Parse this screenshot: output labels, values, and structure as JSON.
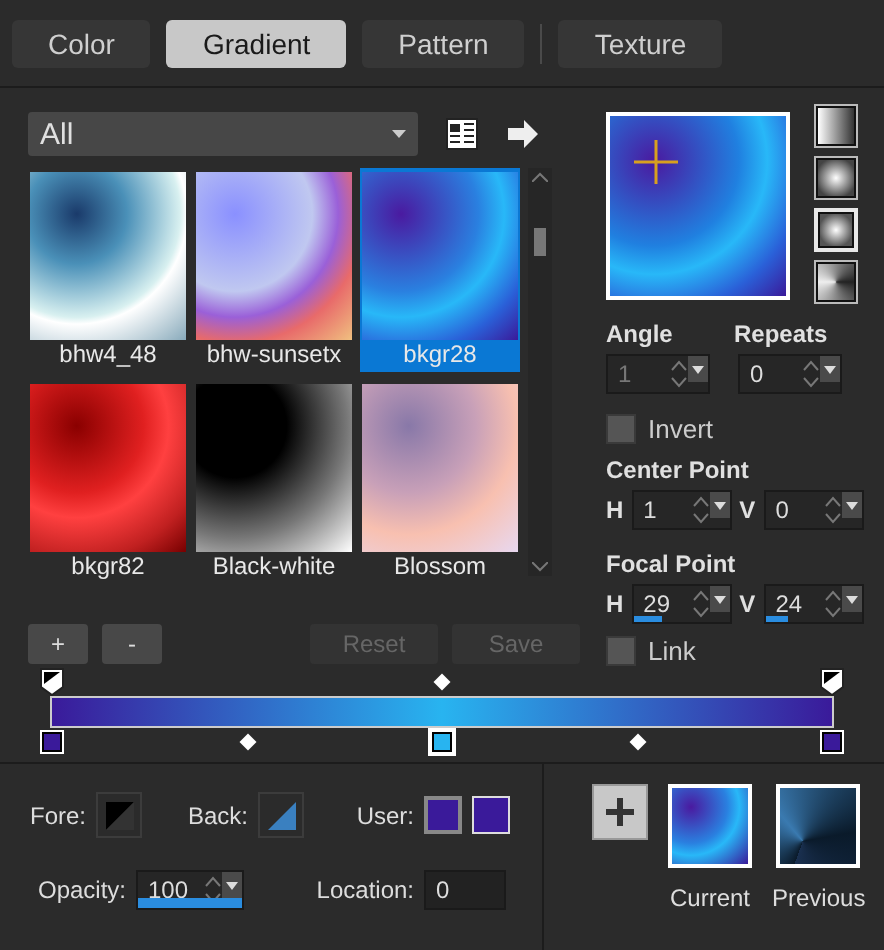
{
  "tabs": [
    {
      "label": "Color",
      "selected": false
    },
    {
      "label": "Gradient",
      "selected": true
    },
    {
      "label": "Pattern",
      "selected": false
    },
    {
      "label": "Texture",
      "selected": false
    }
  ],
  "category": {
    "value": "All"
  },
  "presets": [
    {
      "name": "bhw4_48",
      "selected": false
    },
    {
      "name": "bhw-sunsetx",
      "selected": false
    },
    {
      "name": "bkgr28",
      "selected": true
    },
    {
      "name": "bkgr82",
      "selected": false
    },
    {
      "name": "Black-white",
      "selected": false
    },
    {
      "name": "Blossom",
      "selected": false
    }
  ],
  "preset_buttons": [
    {
      "label": "+",
      "disabled": false
    },
    {
      "label": "-",
      "disabled": false
    },
    {
      "label": "Reset",
      "disabled": true
    },
    {
      "label": "Save",
      "disabled": true
    }
  ],
  "styles": [
    {
      "kind": "linear",
      "selected": false
    },
    {
      "kind": "rectangular",
      "selected": false
    },
    {
      "kind": "sunburst",
      "selected": true
    },
    {
      "kind": "radial",
      "selected": false
    }
  ],
  "angle": {
    "label": "Angle",
    "value": "1",
    "disabled": true
  },
  "repeats": {
    "label": "Repeats",
    "value": "0",
    "disabled": false
  },
  "invert": {
    "label": "Invert",
    "checked": false
  },
  "center_point": {
    "label": "Center Point",
    "h_label": "H",
    "h": "1",
    "v_label": "V",
    "v": "0"
  },
  "focal_point": {
    "label": "Focal Point",
    "h_label": "H",
    "h": {
      "value": "29",
      "level": 0.29
    },
    "v_label": "V",
    "v": {
      "value": "24",
      "level": 0.24
    }
  },
  "link": {
    "label": "Link",
    "checked": false
  },
  "opacity_stops": [
    {
      "selected": false
    },
    {
      "selected": false
    }
  ],
  "color_stops": [
    {
      "color": "#3a1a9a",
      "selected": false
    },
    {
      "color": "#28b4f0",
      "selected": true
    },
    {
      "color": "#3a1a9a",
      "selected": false
    }
  ],
  "fore": {
    "label": "Fore:"
  },
  "back": {
    "label": "Back:"
  },
  "user": {
    "label": "User:",
    "colors": [
      {
        "color": "#3a1a9a",
        "selected": true
      },
      {
        "color": "#3a1a9a",
        "selected": false
      }
    ]
  },
  "opacity": {
    "label": "Opacity:",
    "value": "100",
    "level": 1
  },
  "location": {
    "label": "Location:",
    "value": "0"
  },
  "current": {
    "label": "Current"
  },
  "previous": {
    "label": "Previous"
  }
}
